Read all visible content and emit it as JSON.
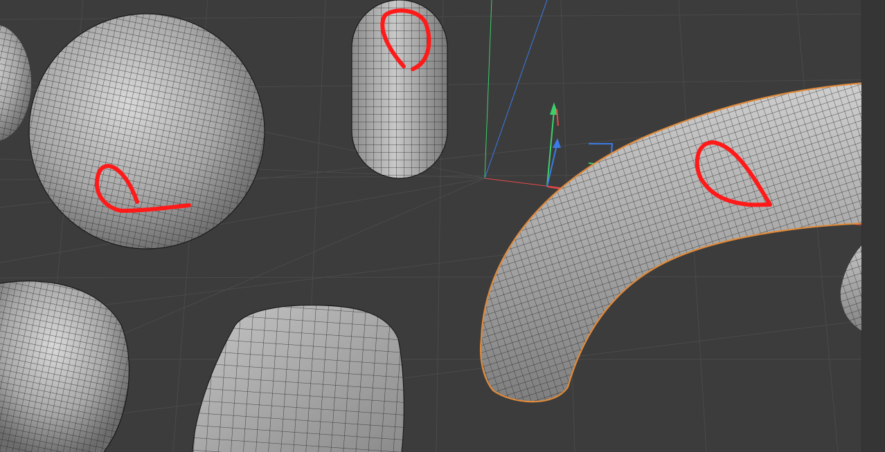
{
  "viewport": {
    "background_color": "#3c3c3c",
    "grid_color": "#4a4a4a",
    "mesh_color": "#b5b5b5",
    "wire_color": "#1a1a1a",
    "selection_outline_color": "#e08a3a",
    "annotation_color": "#ff1a1a",
    "axis_colors": {
      "x": "#e84848",
      "y": "#3bd16a",
      "z": "#3b7be8"
    }
  },
  "objects": [
    {
      "kind": "sphere",
      "selected": false,
      "annotated": true
    },
    {
      "kind": "capsule",
      "selected": false,
      "annotated": true
    },
    {
      "kind": "torus",
      "selected": true,
      "annotated": true
    },
    {
      "kind": "cube",
      "selected": false,
      "annotated": false
    },
    {
      "kind": "cylinder",
      "selected": false,
      "annotated": false
    }
  ],
  "icons": {
    "move_gizmo": "move-gizmo-icon",
    "rotate_gizmo": "axis-gizmo-icon"
  }
}
